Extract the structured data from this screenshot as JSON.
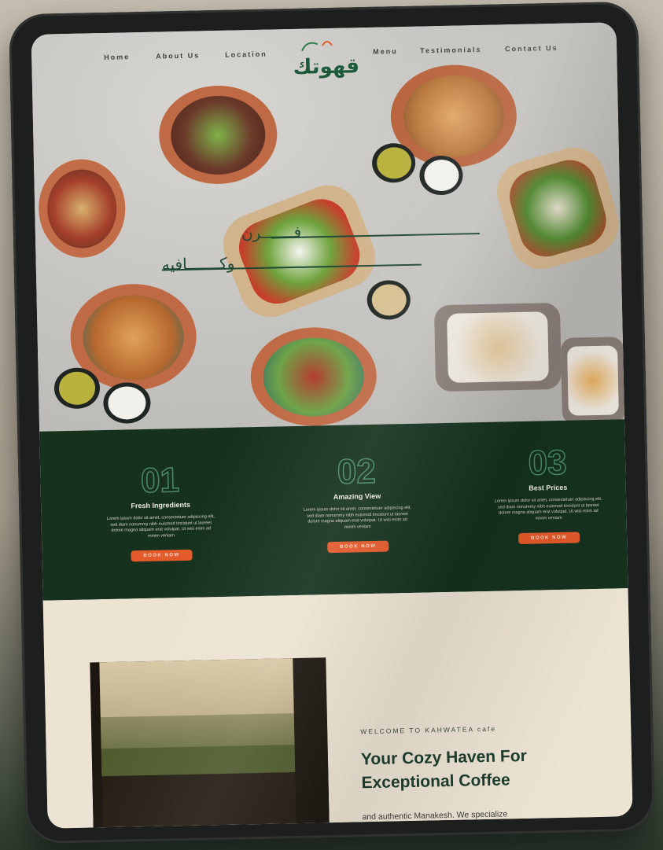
{
  "nav": {
    "items": [
      "Home",
      "About Us",
      "Location",
      "Menu",
      "Testimonials",
      "Contact Us"
    ]
  },
  "logo": {
    "text": "قهوتك"
  },
  "hero": {
    "tagline_line1": "فـــــــرن",
    "tagline_line2": "وكـــــــافيه"
  },
  "features": [
    {
      "number": "01",
      "title": "Fresh Ingredients",
      "desc": "Lorem ipsum dolor sit amet, consectetuer adipiscing elit, sed diam nonummy nibh euismod tincidunt ut laoreet dolore magna aliquam erat volutpat. Ut wisi enim ad minim veniam",
      "button": "BOOK NOW"
    },
    {
      "number": "02",
      "title": "Amazing View",
      "desc": "Lorem ipsum dolor sit amet, consectetuer adipiscing elit, sed diam nonummy nibh euismod tincidunt ut laoreet dolore magna aliquam erat volutpat. Ut wisi enim ad minim veniam",
      "button": "BOOK NOW"
    },
    {
      "number": "03",
      "title": "Best Prices",
      "desc": "Lorem ipsum dolor sit amet, consectetuer adipiscing elit, sed diam nonummy nibh euismod tincidunt ut laoreet dolore magna aliquam erat volutpat. Ut wisi enim ad minim veniam",
      "button": "BOOK NOW"
    }
  ],
  "about": {
    "welcome": "WELCOME TO KAHWATEA cafe",
    "heading": "Your Cozy Haven For Exceptional Coffee",
    "body": "and authentic Manakesh. We specialize"
  },
  "colors": {
    "brand_green": "#16321f",
    "accent_orange": "#e45a2b",
    "cream": "#ece3d3"
  }
}
